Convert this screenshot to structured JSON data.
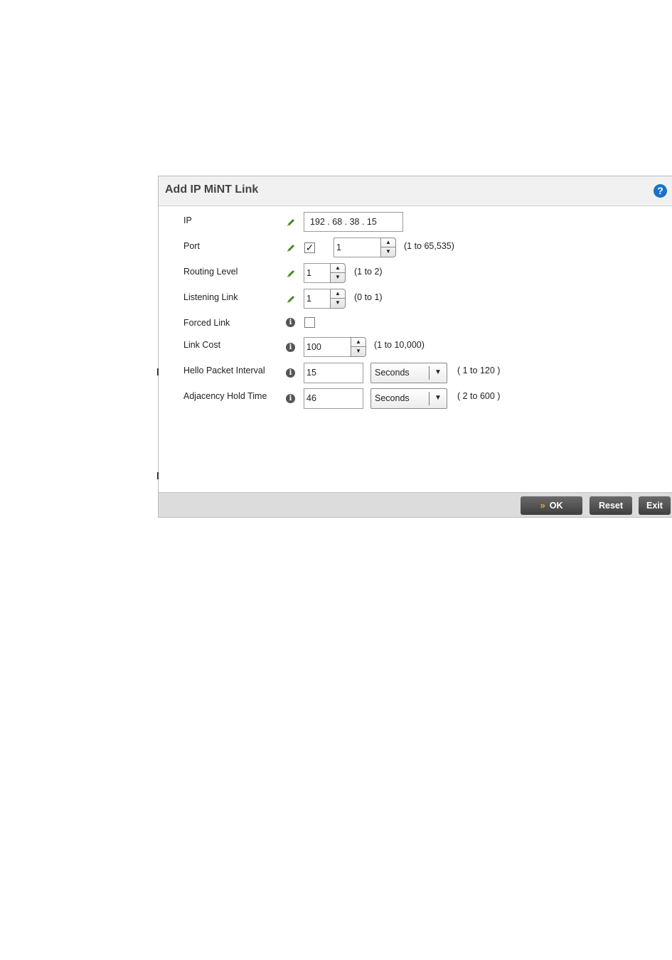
{
  "dialog": {
    "title": "Add IP MiNT Link",
    "help_icon": "question-circle-icon",
    "help_symbol": "?"
  },
  "fields": {
    "ip": {
      "label": "IP",
      "value": "192 . 68 . 38 . 15"
    },
    "port": {
      "label": "Port",
      "checked": true,
      "check_symbol": "✓",
      "value": "1",
      "range": "(1 to 65,535)"
    },
    "routing_level": {
      "label": "Routing Level",
      "value": "1",
      "range": "(1 to 2)"
    },
    "listening_link": {
      "label": "Listening Link",
      "value": "1",
      "range": "(0 to 1)"
    },
    "forced_link": {
      "label": "Forced Link",
      "checked": false
    },
    "link_cost": {
      "label": "Link Cost",
      "value": "100",
      "range": "(1 to 10,000)"
    },
    "hello_packet_interval": {
      "label": "Hello Packet Interval",
      "value": "15",
      "unit": "Seconds",
      "range": "( 1 to 120 )"
    },
    "adjacency_hold_time": {
      "label": "Adjacency Hold Time",
      "value": "46",
      "unit": "Seconds",
      "range": "( 2 to 600 )"
    }
  },
  "icons": {
    "edit": "pencil-icon",
    "info": "info-icon",
    "info_symbol": "i",
    "spin_up": "▲",
    "spin_down": "▼",
    "dropdown": "▼",
    "ok_chevron": "»"
  },
  "footer": {
    "ok_label": "OK",
    "reset_label": "Reset",
    "exit_label": "Exit"
  },
  "colors": {
    "accent_help": "#1a73c8",
    "ok_chevron": "#f5a623",
    "pencil": "#3a8a1e"
  }
}
